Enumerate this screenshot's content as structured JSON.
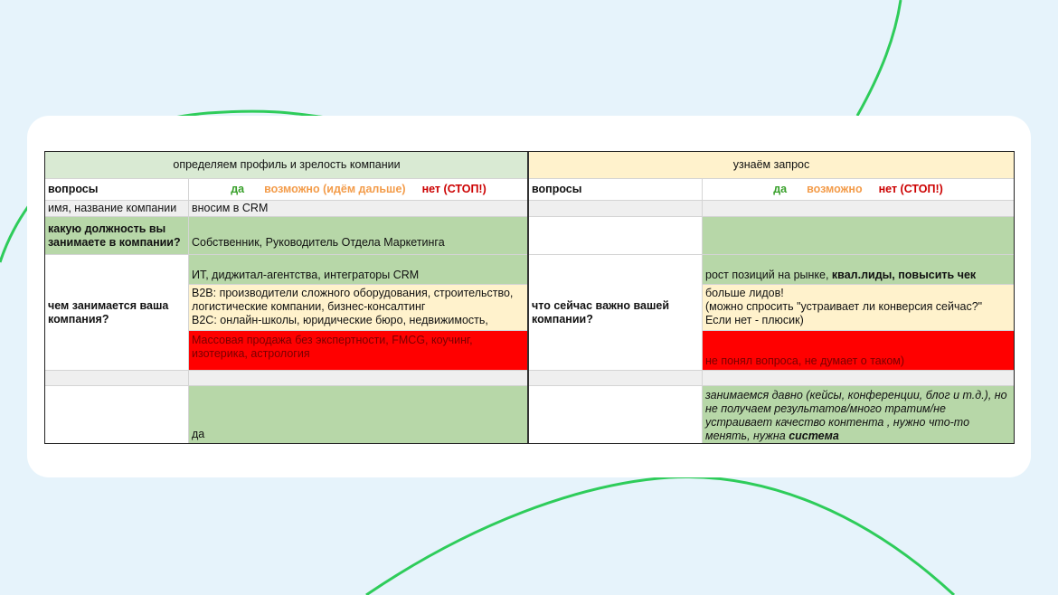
{
  "left_block": {
    "header": "определяем профиль и зрелость компании",
    "col_questions": "вопросы",
    "answers": {
      "yes": "да",
      "maybe": "возможно (идём дальше)",
      "no": "нет (СТОП!)"
    },
    "row_name": {
      "question": "имя, название компании",
      "answer": "вносим в CRM"
    },
    "row_position": {
      "question": "какую должность вы занимаете в компании?",
      "yes": "Собственник, Руководитель Отдела Маркетинга"
    },
    "row_business": {
      "question": "чем занимается ваша компания?",
      "yes": "ИТ, диджитал-агентства, интеграторы CRM",
      "maybe_b2b": "B2B: производители сложного оборудования, строительство, логистические компании, бизнес-консалтинг",
      "maybe_b2c": "B2C: онлайн-школы, юридические бюро, недвижимость,",
      "no": "Массовая продажа без экспертности, FMCG, коучинг, изотерика,  астрология"
    },
    "row_last": {
      "yes": "да"
    }
  },
  "right_block": {
    "header": "узнаём запрос",
    "col_questions": "вопросы",
    "answers": {
      "yes": "да",
      "maybe": "возможно",
      "no": "нет (СТОП!)"
    },
    "row_important": {
      "question": "что сейчас важно вашей компании?",
      "yes_plain": "рост позиций на рынке, ",
      "yes_bold": "квал.лиды, повысить чек",
      "maybe_line1": "больше лидов!",
      "maybe_line2": "(можно спросить \"устраивает ли конверсия сейчас?\"",
      "maybe_line3": "Если нет - плюсик)",
      "no": "не понял вопроса, не думает о таком)"
    },
    "row_last": {
      "yes_text": "занимаемся давно (кейсы, конференции, блог и т.д.), но не получаем результатов/много тратим/не устраивает качество контента , нужно что-то менять, нужна ",
      "yes_bold": "система"
    }
  },
  "colors": {
    "green": "#b7d7a8",
    "light_green": "#d9ead3",
    "yellow": "#fff2cc",
    "red": "#ff0000",
    "curve": "#2ecc5a"
  }
}
